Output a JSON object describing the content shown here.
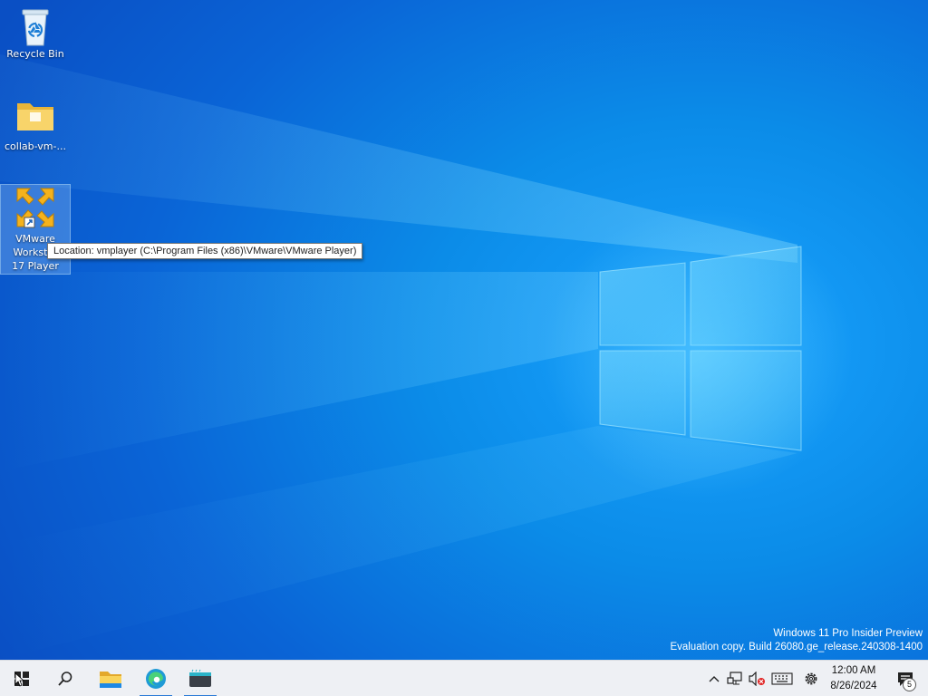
{
  "desktop": {
    "icons": [
      {
        "label": "Recycle Bin",
        "icon": "recycle-bin-icon"
      },
      {
        "label": "collab-vm-...",
        "icon": "folder-icon"
      },
      {
        "label_lines": [
          "VMware",
          "Workstat",
          "17 Player"
        ],
        "icon": "vmware-player-icon"
      }
    ],
    "tooltip": "Location: vmplayer (C:\\Program Files (x86)\\VMware\\VMware Player)",
    "watermark": {
      "line1": "Windows 11 Pro Insider Preview",
      "line2": "Evaluation copy. Build 26080.ge_release.240308-1400"
    }
  },
  "taskbar": {
    "start_icon": "windows-start-icon",
    "search_icon": "search-icon",
    "pinned": [
      {
        "name": "File Explorer",
        "icon": "file-explorer-icon"
      },
      {
        "name": "Microsoft Edge",
        "icon": "edge-icon",
        "active": true
      },
      {
        "name": "Terminal",
        "icon": "terminal-icon",
        "active": true
      }
    ],
    "tray": {
      "icons": [
        "chevron-up-icon",
        "network-icon",
        "volume-muted-icon",
        "keyboard-icon",
        "settings-gear-icon"
      ],
      "time": "12:00 AM",
      "date": "8/26/2024",
      "notification_count": "5"
    }
  },
  "colors": {
    "desktop_blue": "#0a64d6",
    "taskbar_bg": "#eef0f4",
    "accent": "#2a7ad6"
  }
}
